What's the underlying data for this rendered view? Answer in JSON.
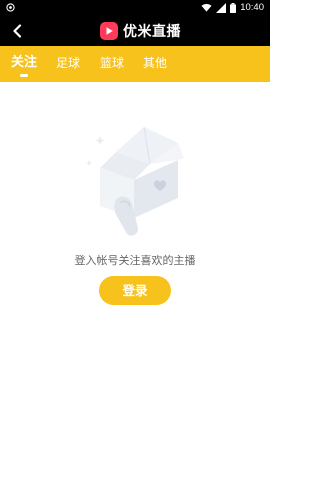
{
  "status_bar": {
    "time": "10:40",
    "icons": [
      "notification-icon",
      "wifi-icon",
      "signal-icon",
      "battery-icon"
    ]
  },
  "app_bar": {
    "title": "优米直播",
    "logo_icon": "play-logo-icon",
    "back_icon": "chevron-left-icon",
    "background": "#000000"
  },
  "tabs": [
    {
      "label": "关注",
      "active": true
    },
    {
      "label": "足球",
      "active": false
    },
    {
      "label": "篮球",
      "active": false
    },
    {
      "label": "其他",
      "active": false
    }
  ],
  "empty_state": {
    "illustration_icon": "empty-box-icon",
    "message": "登入帐号关注喜欢的主播",
    "login_label": "登录"
  },
  "colors": {
    "accent": "#f8c21c",
    "logo": "#ff3b5c",
    "text_muted": "#666666"
  }
}
